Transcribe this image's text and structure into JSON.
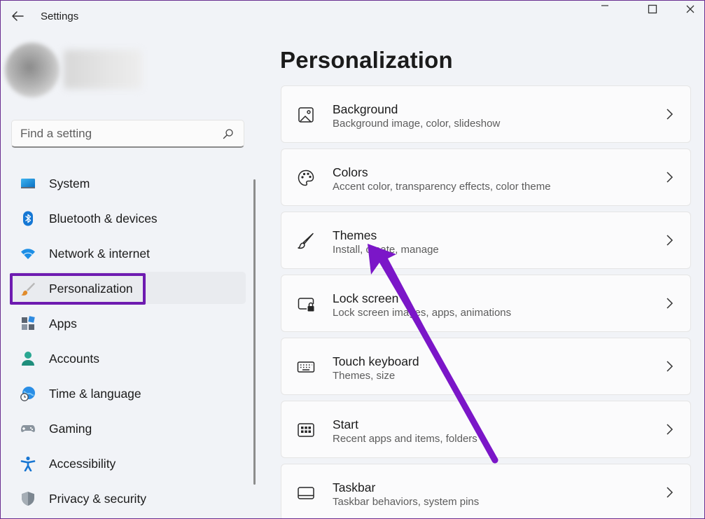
{
  "window": {
    "title": "Settings"
  },
  "search": {
    "placeholder": "Find a setting"
  },
  "sidebar": {
    "items": [
      {
        "label": "System"
      },
      {
        "label": "Bluetooth & devices"
      },
      {
        "label": "Network & internet"
      },
      {
        "label": "Personalization"
      },
      {
        "label": "Apps"
      },
      {
        "label": "Accounts"
      },
      {
        "label": "Time & language"
      },
      {
        "label": "Gaming"
      },
      {
        "label": "Accessibility"
      },
      {
        "label": "Privacy & security"
      }
    ],
    "active_item": "Personalization"
  },
  "main": {
    "title": "Personalization",
    "cards": [
      {
        "title": "Background",
        "subtitle": "Background image, color, slideshow"
      },
      {
        "title": "Colors",
        "subtitle": "Accent color, transparency effects, color theme"
      },
      {
        "title": "Themes",
        "subtitle": "Install, create, manage"
      },
      {
        "title": "Lock screen",
        "subtitle": "Lock screen images, apps, animations"
      },
      {
        "title": "Touch keyboard",
        "subtitle": "Themes, size"
      },
      {
        "title": "Start",
        "subtitle": "Recent apps and items, folders"
      },
      {
        "title": "Taskbar",
        "subtitle": "Taskbar behaviors, system pins"
      }
    ]
  },
  "annotation": {
    "highlight_color": "#6e1bb0"
  },
  "icons": {
    "back": "back-arrow-icon",
    "minimize": "minimize-icon",
    "maximize": "maximize-icon",
    "search": "search-icon",
    "chevron": "chevron-right-icon"
  }
}
